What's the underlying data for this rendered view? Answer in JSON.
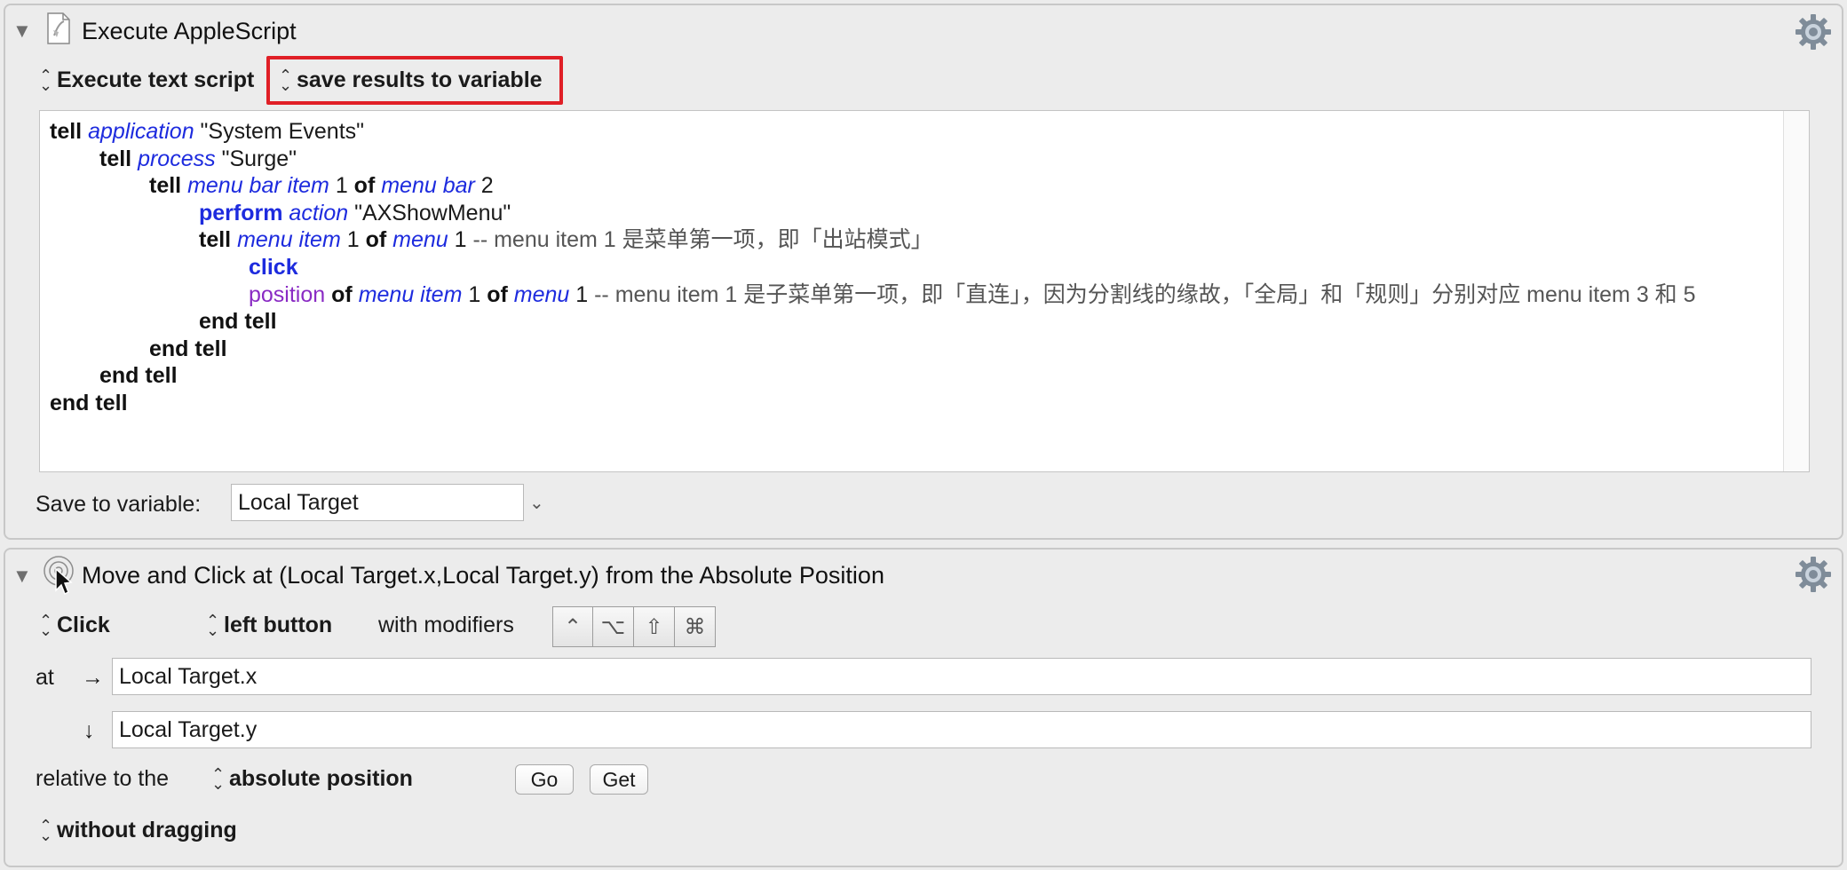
{
  "action1": {
    "title": "Execute AppleScript",
    "popup_execute": "Execute text script",
    "popup_save": "save results to variable",
    "save_to_variable_label": "Save to variable:",
    "save_to_variable_value": "Local Target",
    "icons": {
      "disclosure": "disclosure-triangle-icon",
      "script": "applescript-icon",
      "gear": "gear-icon"
    }
  },
  "script": {
    "lines": [
      [
        {
          "t": "tell",
          "c": "kw"
        },
        {
          "t": " "
        },
        {
          "t": "application",
          "c": "cls"
        },
        {
          "t": " \"System Events\""
        }
      ],
      [
        {
          "t": "tell",
          "c": "kw"
        },
        {
          "t": " "
        },
        {
          "t": "process",
          "c": "cls"
        },
        {
          "t": " \"Surge\""
        }
      ],
      [
        {
          "t": "tell",
          "c": "kw"
        },
        {
          "t": " "
        },
        {
          "t": "menu bar item",
          "c": "cls"
        },
        {
          "t": " 1 "
        },
        {
          "t": "of",
          "c": "kw"
        },
        {
          "t": " "
        },
        {
          "t": "menu bar",
          "c": "cls"
        },
        {
          "t": " 2"
        }
      ],
      [
        {
          "t": "perform",
          "c": "kwb"
        },
        {
          "t": " "
        },
        {
          "t": "action",
          "c": "cls"
        },
        {
          "t": " \"AXShowMenu\""
        }
      ],
      [
        {
          "t": "tell",
          "c": "kw"
        },
        {
          "t": " "
        },
        {
          "t": "menu item",
          "c": "cls"
        },
        {
          "t": " 1 "
        },
        {
          "t": "of",
          "c": "kw"
        },
        {
          "t": " "
        },
        {
          "t": "menu",
          "c": "cls"
        },
        {
          "t": " 1 "
        },
        {
          "t": "-- menu item 1 是菜单第一项，即「出站模式」",
          "c": "cmt"
        }
      ],
      [
        {
          "t": "click",
          "c": "kwb"
        }
      ],
      [
        {
          "t": "position",
          "c": "prop"
        },
        {
          "t": " "
        },
        {
          "t": "of",
          "c": "kw"
        },
        {
          "t": " "
        },
        {
          "t": "menu item",
          "c": "cls"
        },
        {
          "t": " 1 "
        },
        {
          "t": "of",
          "c": "kw"
        },
        {
          "t": " "
        },
        {
          "t": "menu",
          "c": "cls"
        },
        {
          "t": " 1 "
        },
        {
          "t": "-- menu item 1 是子菜单第一项，即「直连」，因为分割线的缘故，「全局」和「规则」分别对应 menu item 3 和 5",
          "c": "cmt"
        }
      ],
      [
        {
          "t": "end tell",
          "c": "kw"
        }
      ],
      [
        {
          "t": "end tell",
          "c": "kw"
        }
      ],
      [
        {
          "t": "end tell",
          "c": "kw"
        }
      ],
      [
        {
          "t": "end tell",
          "c": "kw"
        }
      ]
    ]
  },
  "action2": {
    "title": "Move and Click at (Local Target.x,Local Target.y) from the Absolute Position",
    "popup_click": "Click",
    "popup_button": "left button",
    "with_modifiers_label": "with modifiers",
    "modifiers": [
      "⌃",
      "⌥",
      "⇧",
      "⌘"
    ],
    "at_label": "at",
    "arrow_right": "→",
    "arrow_down": "↓",
    "x_value": "Local Target.x",
    "y_value": "Local Target.y",
    "relative_label": "relative to the",
    "popup_position": "absolute position",
    "go_label": "Go",
    "get_label": "Get",
    "popup_drag": "without dragging",
    "icons": {
      "disclosure": "disclosure-triangle-icon",
      "action": "mouse-click-icon",
      "gear": "gear-icon"
    }
  }
}
